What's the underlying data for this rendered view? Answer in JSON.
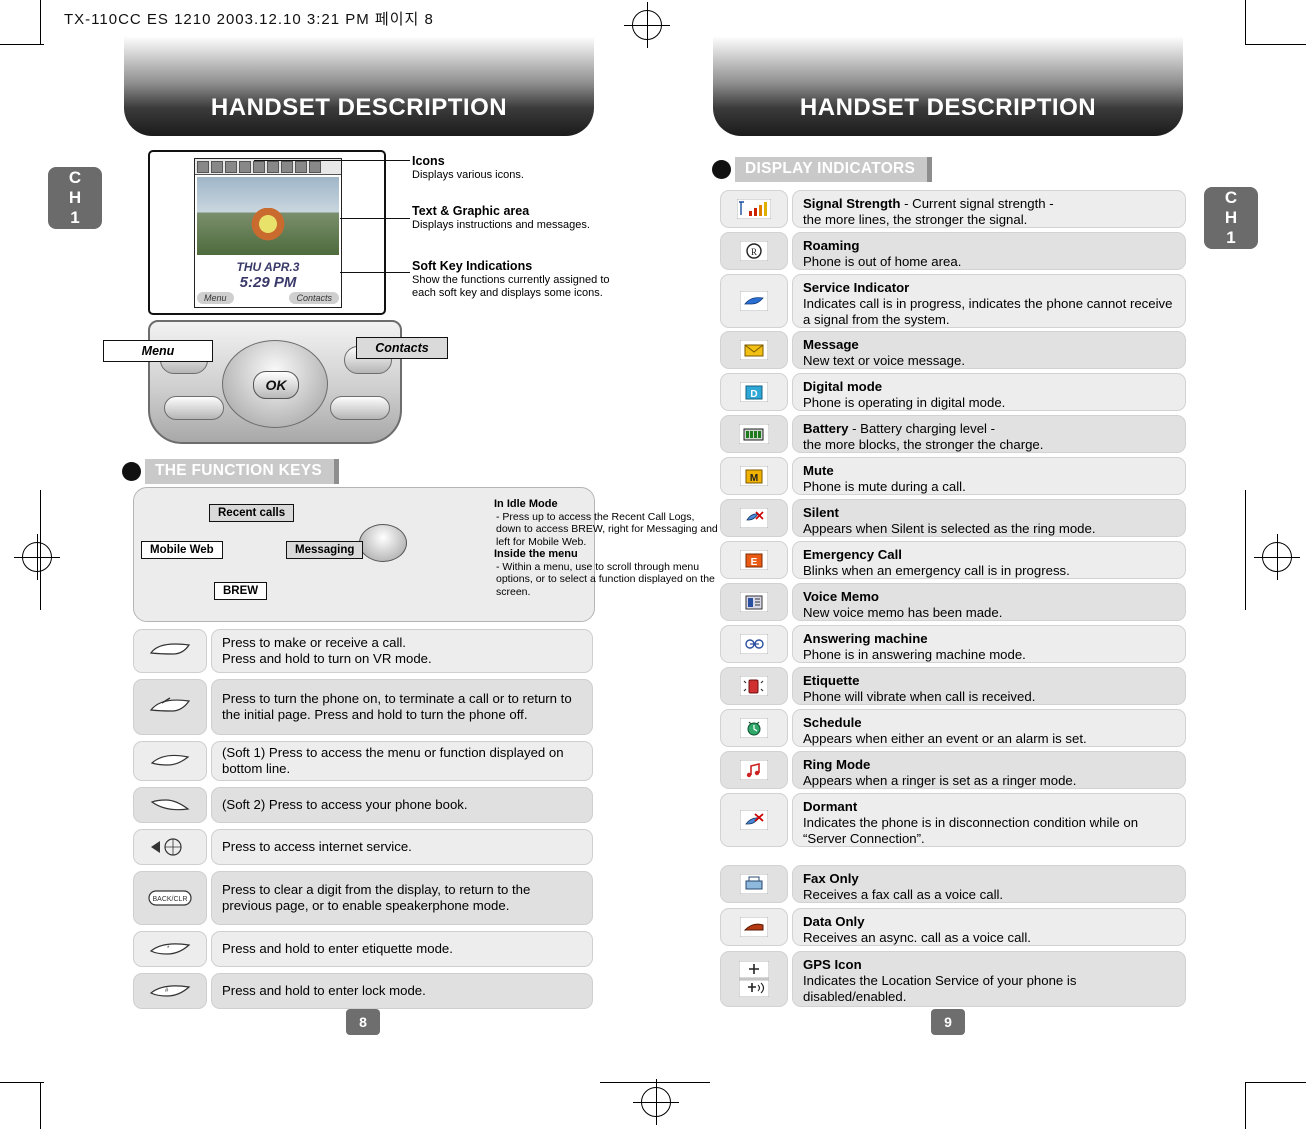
{
  "file_mark": "TX-110CC ES 1210  2003.12.10 3:21 PM 페이지 8",
  "left_page": {
    "banner_title": "HANDSET DESCRIPTION",
    "chapter": {
      "line1": "C",
      "line2": "H",
      "line3": "1"
    },
    "page_number": "8",
    "screen": {
      "date": "THU APR.3",
      "time": "5:29 PM",
      "soft_left": "Menu",
      "soft_right": "Contacts"
    },
    "callouts": [
      {
        "title": "Icons",
        "text": "Displays various icons."
      },
      {
        "title": "Text & Graphic area",
        "text": "Displays instructions and messages."
      },
      {
        "title": "Soft Key Indications",
        "text": "Show the functions currently assigned to each soft key and displays some icons."
      }
    ],
    "key_labels": {
      "menu": "Menu",
      "contacts": "Contacts"
    },
    "section_title": "THE FUNCTION KEYS",
    "function_keys_diagram": {
      "top_label": "Recent calls",
      "left_label": "Mobile Web",
      "right_label": "Messaging",
      "bottom_label": "BREW",
      "idle_heading": "In Idle Mode",
      "idle_text": "- Press up to access the Recent Call Logs, down to access BREW, right for Messaging and left for Mobile Web.",
      "menu_heading": "Inside the menu",
      "menu_text": "- Within a menu, use to scroll through menu options, or to select a function displayed on the screen."
    },
    "key_rows": [
      {
        "icon": "send-key-icon",
        "text": "Press to make or receive a call.\nPress and hold to turn on VR mode."
      },
      {
        "icon": "end-power-key-icon",
        "text": "Press to turn the phone on, to terminate a call or to return to the initial page.  Press and hold to turn the phone off."
      },
      {
        "icon": "soft-key-1-icon",
        "text": "(Soft 1) Press to access the menu or function displayed on bottom line."
      },
      {
        "icon": "soft-key-2-icon",
        "text": "(Soft 2) Press to access your phone book."
      },
      {
        "icon": "internet-key-icon",
        "text": "Press to access internet service."
      },
      {
        "icon": "back-clear-key-icon",
        "text": "Press to clear a digit from the display, to return to the previous page, or to enable speakerphone mode."
      },
      {
        "icon": "etiquette-key-icon",
        "text": "Press and hold to enter etiquette mode."
      },
      {
        "icon": "lock-key-icon",
        "text": "Press and hold to enter lock mode."
      }
    ]
  },
  "right_page": {
    "banner_title": "HANDSET DESCRIPTION",
    "chapter": {
      "line1": "C",
      "line2": "H",
      "line3": "1"
    },
    "page_number": "9",
    "section_title": "DISPLAY INDICATORS",
    "indicators": [
      {
        "icon": "signal-strength-icon",
        "title": "Signal Strength",
        "title_suffix": " - Current signal strength -",
        "desc": "the more lines, the stronger the signal."
      },
      {
        "icon": "roaming-icon",
        "title": "Roaming",
        "title_suffix": "",
        "desc": "Phone is out of home area."
      },
      {
        "icon": "service-indicator-icon",
        "title": "Service Indicator",
        "title_suffix": "",
        "desc": "Indicates call is in progress,  indicates the phone cannot receive a signal from the system."
      },
      {
        "icon": "message-icon",
        "title": "Message",
        "title_suffix": "",
        "desc": "New text or voice message."
      },
      {
        "icon": "digital-mode-icon",
        "title": "Digital mode",
        "title_suffix": "",
        "desc": "Phone is operating in digital mode."
      },
      {
        "icon": "battery-icon",
        "title": "Battery",
        "title_suffix": " - Battery charging level -",
        "desc": "the more blocks, the stronger the charge."
      },
      {
        "icon": "mute-icon",
        "title": "Mute",
        "title_suffix": "",
        "desc": "Phone is mute during a call."
      },
      {
        "icon": "silent-icon",
        "title": "Silent",
        "title_suffix": "",
        "desc": "Appears when Silent is selected as the ring mode."
      },
      {
        "icon": "emergency-call-icon",
        "title": "Emergency Call",
        "title_suffix": "",
        "desc": "Blinks when an emergency call is in progress."
      },
      {
        "icon": "voice-memo-icon",
        "title": "Voice Memo",
        "title_suffix": "",
        "desc": "New voice memo has been made."
      },
      {
        "icon": "answering-machine-icon",
        "title": "Answering machine",
        "title_suffix": "",
        "desc": "Phone is in answering machine mode."
      },
      {
        "icon": "etiquette-icon",
        "title": "Etiquette",
        "title_suffix": "",
        "desc": "Phone will vibrate when call is received."
      },
      {
        "icon": "schedule-icon",
        "title": "Schedule",
        "title_suffix": "",
        "desc": "Appears when either an event or an alarm is set."
      },
      {
        "icon": "ring-mode-icon",
        "title": "Ring Mode",
        "title_suffix": "",
        "desc": "Appears when a ringer is set as a ringer mode."
      },
      {
        "icon": "dormant-icon",
        "title": "Dormant",
        "title_suffix": "",
        "desc": "Indicates the phone is in disconnection condition while on “Server Connection”."
      },
      {
        "icon": "fax-only-icon",
        "title": "Fax Only",
        "title_suffix": "",
        "desc": "Receives a fax call as a voice call."
      },
      {
        "icon": "data-only-icon",
        "title": "Data Only",
        "title_suffix": "",
        "desc": "Receives an async. call as a voice call."
      },
      {
        "icon": "gps-icon",
        "title": "GPS Icon",
        "title_suffix": "",
        "desc": "Indicates the Location Service of your phone is disabled/enabled."
      }
    ]
  },
  "colors": {
    "banner_dark": "#1b1b1b",
    "row_grey": "#ededed",
    "row_grey_alt": "#e0e0e0",
    "chapter_tab": "#6b6b6b"
  }
}
